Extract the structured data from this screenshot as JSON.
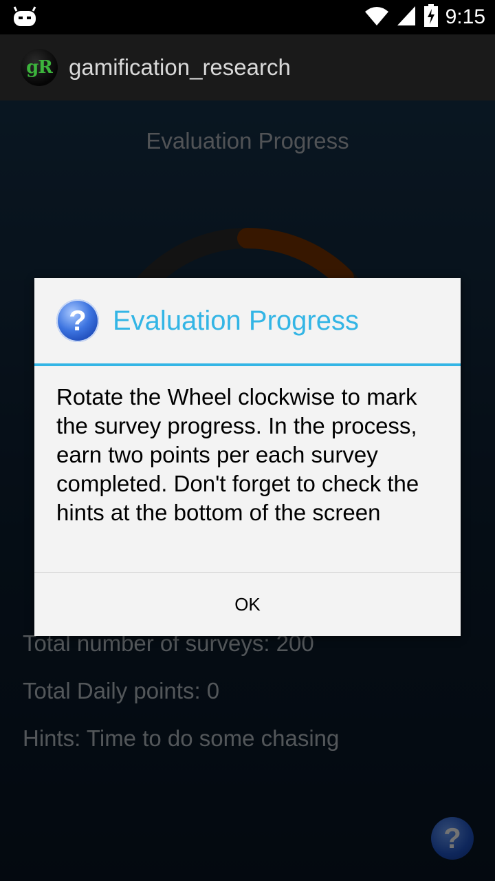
{
  "status_bar": {
    "left_icon": "cyanogen-mascot-icon",
    "icons": [
      "wifi-icon",
      "signal-icon",
      "battery-charging-icon"
    ],
    "time": "9:15"
  },
  "action_bar": {
    "app_icon_text": "gR",
    "title": "gamification_research"
  },
  "screen": {
    "title": "Evaluation Progress",
    "stats": [
      "Total number of surveys: 200",
      "Total Daily points: 0",
      "Hints: Time to do some chasing"
    ],
    "help_button": "?",
    "wheel_colors": {
      "track": "#2a2a2a",
      "progress": "#7a3400"
    }
  },
  "dialog": {
    "icon": "question-icon",
    "title": "Evaluation Progress",
    "message": "Rotate the Wheel clockwise to mark the survey progress. In the process, earn two points per each survey completed. Don't forget to check the hints at the bottom of the screen",
    "ok_label": "OK",
    "accent_color": "#33b5e5"
  }
}
